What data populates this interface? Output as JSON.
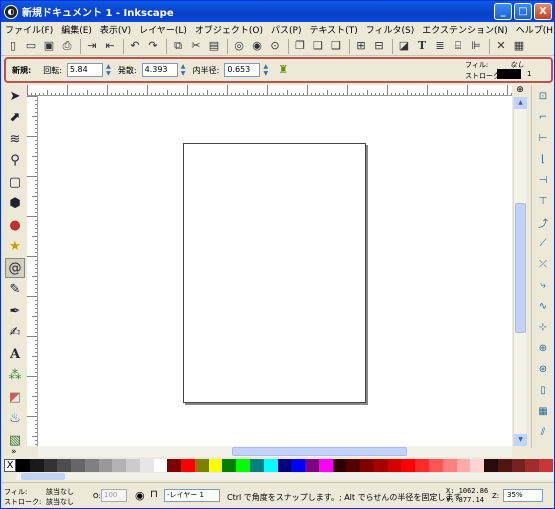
{
  "window": {
    "title": "新規ドキュメント 1 - Inkscape",
    "app_icon": "inkscape-icon",
    "controls": [
      "_",
      "□",
      "X"
    ]
  },
  "menubar": {
    "items": [
      "ファイル(F)",
      "編集(E)",
      "表示(V)",
      "レイヤー(L)",
      "オブジェクト(O)",
      "パス(P)",
      "テキスト(T)",
      "フィルタ(S)",
      "エクステンション(N)",
      "ヘルプ(H)"
    ]
  },
  "commands": {
    "icons": [
      "new-document-icon",
      "open-icon",
      "save-icon",
      "print-icon",
      "import-icon",
      "export-icon",
      "undo-icon",
      "redo-icon",
      "copy-icon",
      "cut-icon",
      "paste-icon",
      "zoom-selection-icon",
      "zoom-drawing-icon",
      "zoom-page-icon",
      "duplicate-icon",
      "clone-icon",
      "unlink-clone-icon",
      "group-icon",
      "ungroup-icon",
      "fill-stroke-icon",
      "text-font-icon",
      "layers-icon",
      "xml-editor-icon",
      "align-icon",
      "preferences-icon",
      "document-properties-icon"
    ]
  },
  "tool_controls": {
    "new_label": "新規:",
    "rotation_label": "回転:",
    "rotation_value": "5.84",
    "divergence_label": "発散:",
    "divergence_value": "4.393",
    "inner_radius_label": "内半径:",
    "inner_radius_value": "0.653",
    "reset_icon": "reset-broom-icon"
  },
  "style_indicator": {
    "fill_label": "フィル:",
    "fill_value": "なし",
    "stroke_label": "ストローク:",
    "stroke_color": "#000000",
    "stroke_width": "1"
  },
  "toolbox": {
    "tools": [
      "selector-arrow-icon",
      "node-editor-icon",
      "tweak-icon",
      "zoom-icon",
      "rectangle-icon",
      "3d-box-icon",
      "ellipse-icon",
      "star-icon",
      "spiral-icon",
      "pencil-icon",
      "pen-icon",
      "calligraphy-icon",
      "text-tool-icon",
      "spray-icon",
      "eraser-icon",
      "paint-bucket-icon",
      "gradient-icon"
    ],
    "active_tool": 8,
    "more": "»"
  },
  "snap_controls": {
    "icons": [
      "snap-enable-icon",
      "snap-bbox-icon",
      "snap-bbox-edge-icon",
      "snap-bbox-corner-icon",
      "snap-bbox-midpoint-icon",
      "snap-bbox-center-icon",
      "snap-nodes-icon",
      "snap-path-icon",
      "snap-intersection-icon",
      "snap-cusp-icon",
      "snap-smooth-icon",
      "snap-midpoint-icon",
      "snap-object-center-icon",
      "snap-rotation-center-icon",
      "snap-page-border-icon",
      "snap-grid-icon",
      "snap-guide-icon"
    ]
  },
  "palette": {
    "none_symbol": "X",
    "colors": [
      "#000000",
      "#1a1a1a",
      "#333333",
      "#4d4d4d",
      "#666666",
      "#808080",
      "#999999",
      "#b3b3b3",
      "#cccccc",
      "#e6e6e6",
      "#ffffff",
      "#800000",
      "#ff0000",
      "#808000",
      "#ffff00",
      "#008000",
      "#00ff00",
      "#008080",
      "#00ffff",
      "#000080",
      "#0000ff",
      "#800080",
      "#ff00ff",
      "#2b0000",
      "#550000",
      "#800000",
      "#aa0000",
      "#d40000",
      "#ff0000",
      "#ff2a2a",
      "#ff5555",
      "#ff8080",
      "#ffaaaa",
      "#ffd5d5",
      "#280b0b",
      "#501616",
      "#782121",
      "#a02c2c",
      "#c83737"
    ]
  },
  "statusbar": {
    "fill_label": "フィル:",
    "fill_value": "該当なし",
    "stroke_label": "ストローク:",
    "stroke_value": "該当なし",
    "opacity_label": "O:",
    "opacity_value": "100",
    "layer_value": "-レイヤー 1",
    "message": "Ctrl で角度をスナップします。; Alt でらせんの半径を固定します",
    "x_label": "X:",
    "x_value": "1062.86",
    "y_label": "Y:",
    "y_value": "877.14",
    "zoom_label": "Z:",
    "zoom_value": "35%"
  }
}
